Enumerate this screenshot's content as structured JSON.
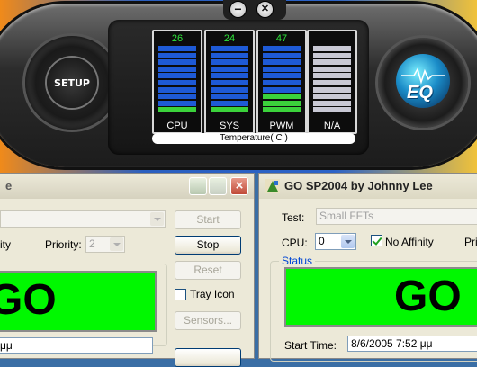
{
  "eq_monitor": {
    "setup_label": "SETUP",
    "eq_label": "EQ",
    "minimize_symbol": "−",
    "close_symbol": "✕",
    "gauges": [
      {
        "label": "CPU",
        "value": "26",
        "level": 0.08,
        "color": "#1e5ad6",
        "fill": "#3bd23b"
      },
      {
        "label": "SYS",
        "value": "24",
        "level": 0.08,
        "color": "#1e5ad6",
        "fill": "#3bd23b"
      },
      {
        "label": "PWM",
        "value": "47",
        "level": 0.25,
        "color": "#1e5ad6",
        "fill": "#3bd23b"
      },
      {
        "label": "N/A",
        "value": "",
        "level": 0.0,
        "color": "#c8c8d4",
        "fill": "#c8c8d4"
      }
    ],
    "temperature_label": "Temperature( C )"
  },
  "left_window": {
    "title": "e",
    "priority_label": "Priority:",
    "priority_value": "2",
    "affinity_label_partial": "ity",
    "start_label": "Start",
    "stop_label": "Stop",
    "reset_label": "Reset",
    "tray_icon_label": "Tray Icon",
    "sensors_label": "Sensors...",
    "status_text": "GO",
    "footer_partial": "μμ"
  },
  "right_window": {
    "title": "GO SP2004 by Johnny Lee",
    "test_label": "Test:",
    "test_value": "Small FFTs",
    "cpu_label": "CPU:",
    "cpu_value": "0",
    "no_affinity_label": "No Affinity",
    "priority_partial": "Prio",
    "status_group_label": "Status",
    "status_text": "GO",
    "start_time_label": "Start Time:",
    "start_time_value": "8/6/2005 7:52 μμ"
  },
  "colors": {
    "go_green": "#00f800",
    "gauge_blue": "#1e5ad6",
    "gauge_value_green": "#2ee53a"
  }
}
